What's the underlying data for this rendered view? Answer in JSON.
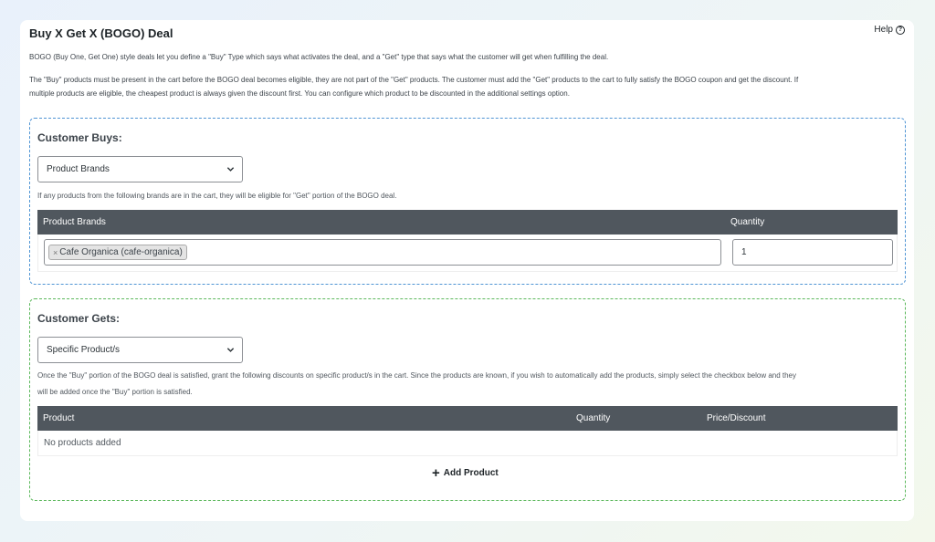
{
  "panel": {
    "title": "Buy X Get X (BOGO) Deal",
    "help_label": "Help",
    "help_icon": "question-circle-icon",
    "intro": "BOGO (Buy One, Get One) style deals let you define a \"Buy\" Type which says what activates the deal, and a \"Get\" type that says what the customer will get when fulfilling the deal.",
    "details_line1": "The \"Buy\" products must be present in the cart before the BOGO deal becomes eligible, they are not part of the \"Get\" products. The customer must add the \"Get\" products to the cart to fully satisfy the BOGO coupon and get the discount. If",
    "details_line2": "multiple products are eligible, the cheapest product is always given the discount first. You can configure which product to be discounted in the additional settings option."
  },
  "buys": {
    "title": "Customer Buys:",
    "type_selected": "Product Brands",
    "note": "If any products from the following brands are in the cart, they will be eligible for \"Get\" portion of the BOGO deal.",
    "columns": [
      "Product Brands",
      "Quantity"
    ],
    "rows": [
      {
        "tag": "Cafe Organica (cafe-organica)",
        "tag_remove": "×",
        "quantity": "1"
      }
    ]
  },
  "gets": {
    "title": "Customer Gets:",
    "type_selected": "Specific Product/s",
    "note_line1": "Once the \"Buy\" portion of the BOGO deal is satisfied, grant the following discounts on specific product/s in the cart. Since the products are known, if you wish to automatically add the products, simply select the checkbox below and they",
    "note_line2": "will be added once the \"Buy\" portion is satisfied.",
    "columns": [
      "Product",
      "Quantity",
      "Price/Discount"
    ],
    "empty_text": "No products added",
    "add_button_label": "Add Product",
    "add_icon": "plus-icon"
  },
  "colors": {
    "buys_border": "#4f94d4",
    "gets_border": "#5cb85c",
    "table_header": "#50575e"
  }
}
